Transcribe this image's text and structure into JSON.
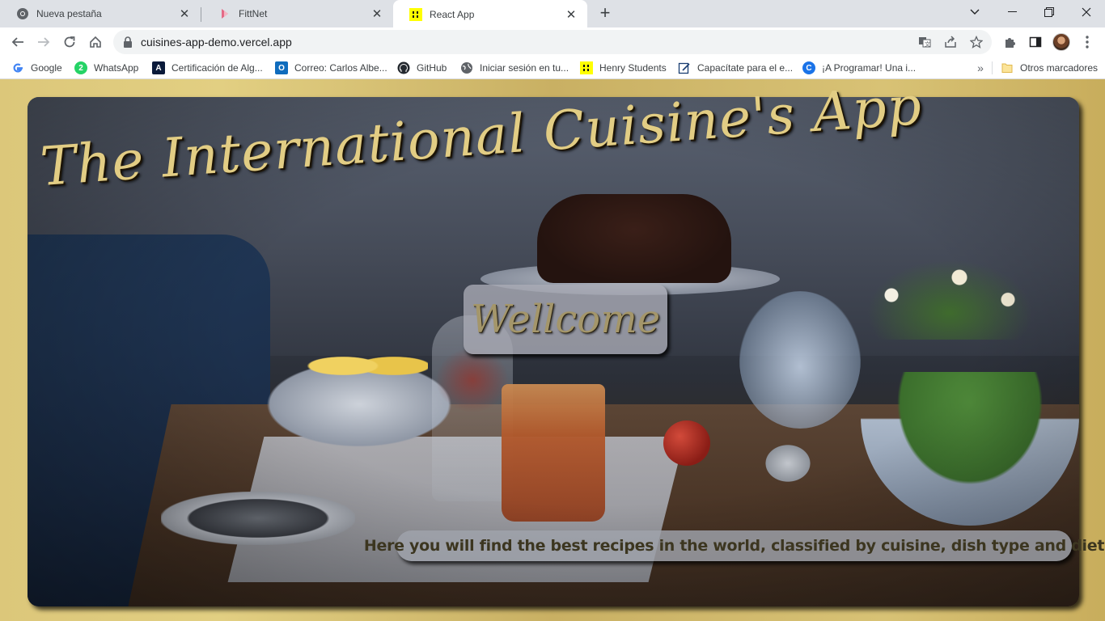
{
  "browser": {
    "tabs": [
      {
        "label": "Nueva pestaña",
        "icon": "chrome-icon"
      },
      {
        "label": "FittNet",
        "icon": "fittnet-icon"
      },
      {
        "label": "React App",
        "icon": "henry-icon",
        "active": true
      }
    ],
    "url": "cuisines-app-demo.vercel.app",
    "bookmarks": [
      {
        "label": "Google",
        "icon": "google-icon"
      },
      {
        "label": "WhatsApp",
        "icon": "whatsapp-icon"
      },
      {
        "label": "Certificación de Alg...",
        "icon": "algorithm-icon"
      },
      {
        "label": "Correo: Carlos Albe...",
        "icon": "outlook-icon"
      },
      {
        "label": "GitHub",
        "icon": "github-icon"
      },
      {
        "label": "Iniciar sesión en tu...",
        "icon": "globe-icon"
      },
      {
        "label": "Henry Students",
        "icon": "henry-icon"
      },
      {
        "label": "Capacítate para el e...",
        "icon": "edit-icon"
      },
      {
        "label": "¡A Programar! Una i...",
        "icon": "chrome-c-icon"
      }
    ],
    "other_bookmarks": "Otros marcadores",
    "overflow": "»"
  },
  "page": {
    "title": "The International Cuisine's App",
    "welcome_button": "Wellcome",
    "subtitle": "Here you will find the best recipes in the world, classified by cuisine, dish type and diet"
  },
  "colors": {
    "page_bg": "#d4bd6f",
    "title": "#e2cd84",
    "welcome_text": "#a4966a"
  }
}
